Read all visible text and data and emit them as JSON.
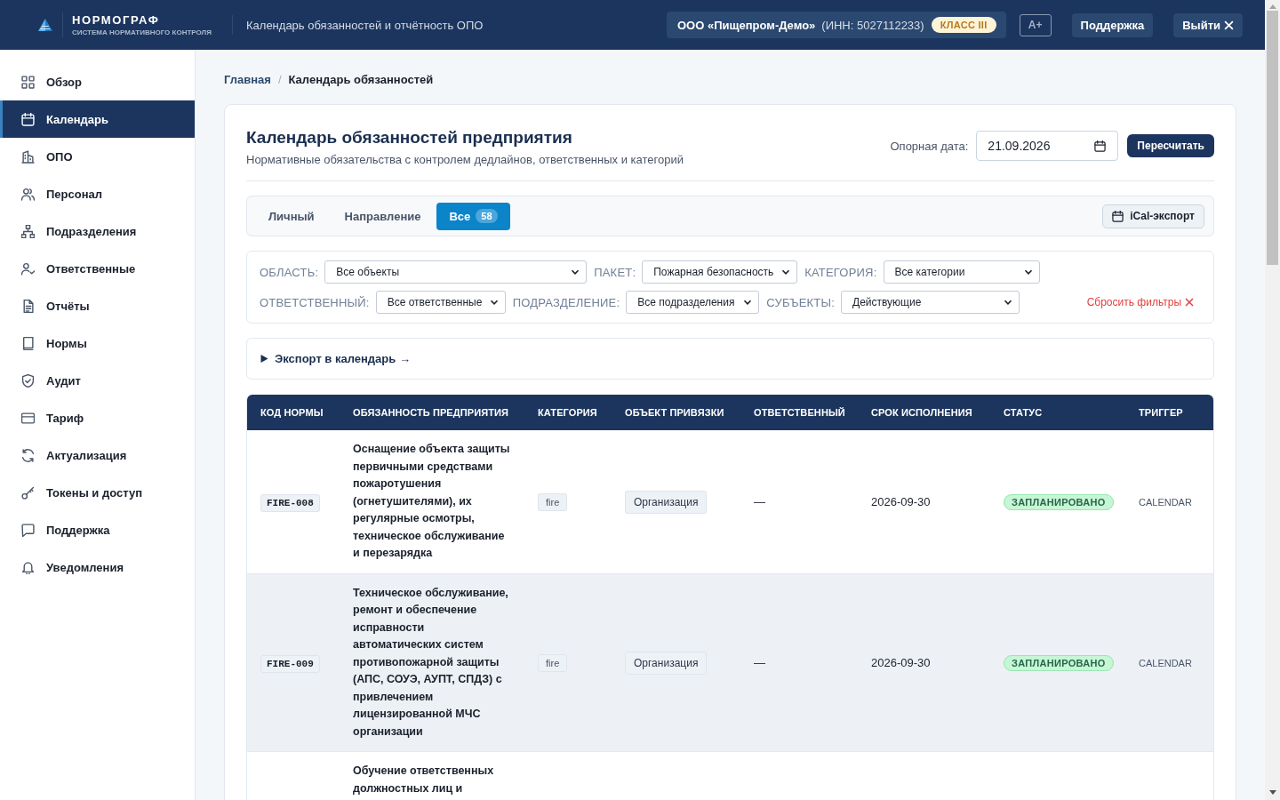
{
  "header": {
    "logo_title": "НОРМОГРАФ",
    "logo_subtitle": "СИСТЕМА НОРМАТИВНОГО КОНТРОЛЯ",
    "section_title": "Календарь обязанностей и отчётность ОПО",
    "org": {
      "name": "ООО «Пищепром-Демо»",
      "inn": "(ИНН: 5027112233)",
      "class_badge": "КЛАСС III"
    },
    "buttons": [
      {
        "kind": "outline",
        "label": "A+"
      },
      {
        "kind": "plain",
        "label": "Поддержка"
      },
      {
        "kind": "logout",
        "label": "Выйти"
      }
    ]
  },
  "sidebar": {
    "items": [
      {
        "label": "Обзор",
        "selected": false
      },
      {
        "label": "Календарь",
        "selected": true
      },
      {
        "label": "ОПО",
        "selected": false
      },
      {
        "label": "Персонал",
        "selected": false
      },
      {
        "label": "Подразделения",
        "selected": false
      },
      {
        "label": "Ответственные",
        "selected": false
      },
      {
        "label": "Отчёты",
        "selected": false
      },
      {
        "label": "Нормы",
        "selected": false
      },
      {
        "label": "Аудит",
        "selected": false
      },
      {
        "label": "Тариф",
        "selected": false
      },
      {
        "label": "Актуализация",
        "selected": false
      },
      {
        "label": "Токены и доступ",
        "selected": false
      },
      {
        "label": "Поддержка",
        "selected": false
      },
      {
        "label": "Уведомления",
        "selected": false
      }
    ]
  },
  "breadcrumb": {
    "separator": "/",
    "items": [
      "Главная",
      "Календарь обязанностей"
    ]
  },
  "page": {
    "title": "Календарь обязанностей предприятия",
    "subtitle": "Нормативные обязательства с контролем дедлайнов, ответственных и категорий",
    "date_label": "Опорная дата:",
    "date_value": "21.09.2026",
    "recalc_button": "Пересчитать"
  },
  "tabs": [
    {
      "label": "Личный",
      "selected": false
    },
    {
      "label": "Направление",
      "selected": false
    },
    {
      "label": "Все",
      "count": "58",
      "selected": true
    }
  ],
  "ical_button": "iCal-экспорт",
  "filter_rows": [
    {
      "filters": [
        {
          "label": "ОБЛАСТЬ:",
          "value": "Все объекты"
        },
        {
          "label": "ПАКЕТ:",
          "value": "Пожарная безопасность"
        },
        {
          "label": "КАТЕГОРИЯ:",
          "value": "Все категории"
        }
      ]
    },
    {
      "filters": [
        {
          "label": "ОТВЕТСТВЕННЫЙ:",
          "value": "Все ответственные"
        },
        {
          "label": "ПОДРАЗДЕЛЕНИЕ:",
          "value": "Все подразделения"
        },
        {
          "label": "СУБЪЕКТЫ:",
          "value": "Действующие"
        }
      ]
    }
  ],
  "reset_filters": "Сбросить фильтры",
  "export_section": {
    "label": "Экспорт в календарь →",
    "expanded": false
  },
  "table": {
    "columns": [
      "КОД НОРМЫ",
      "ОБЯЗАННОСТЬ ПРЕДПРИЯТИЯ",
      "КАТЕГОРИЯ",
      "ОБЪЕКТ ПРИВЯЗКИ",
      "ОТВЕТСТВЕННЫЙ",
      "СРОК ИСПОЛНЕНИЯ",
      "СТАТУС",
      "ТРИГГЕР"
    ],
    "rows": [
      {
        "code": "FIRE-008",
        "duty": "Оснащение объекта защиты первичными средствами пожаротушения (огнетушителями), их регулярные осмотры, техническое обслуживание и перезарядка",
        "category": "fire",
        "object": "Организация",
        "responsible": "—",
        "deadline": "2026-09-30",
        "status": "ЗАПЛАНИРОВАНО",
        "trigger": "CALENDAR"
      },
      {
        "code": "FIRE-009",
        "duty": "Техническое обслуживание, ремонт и обеспечение исправности автоматических систем противопожарной защиты (АПС, СОУЭ, АУПТ, СПДЗ) с привлечением лицензированной МЧС организации",
        "category": "fire",
        "object": "Организация",
        "responsible": "—",
        "deadline": "2026-09-30",
        "status": "ЗАПЛАНИРОВАНО",
        "trigger": "CALENDAR"
      },
      {
        "duty": "Обучение ответственных должностных лиц и"
      }
    ]
  }
}
